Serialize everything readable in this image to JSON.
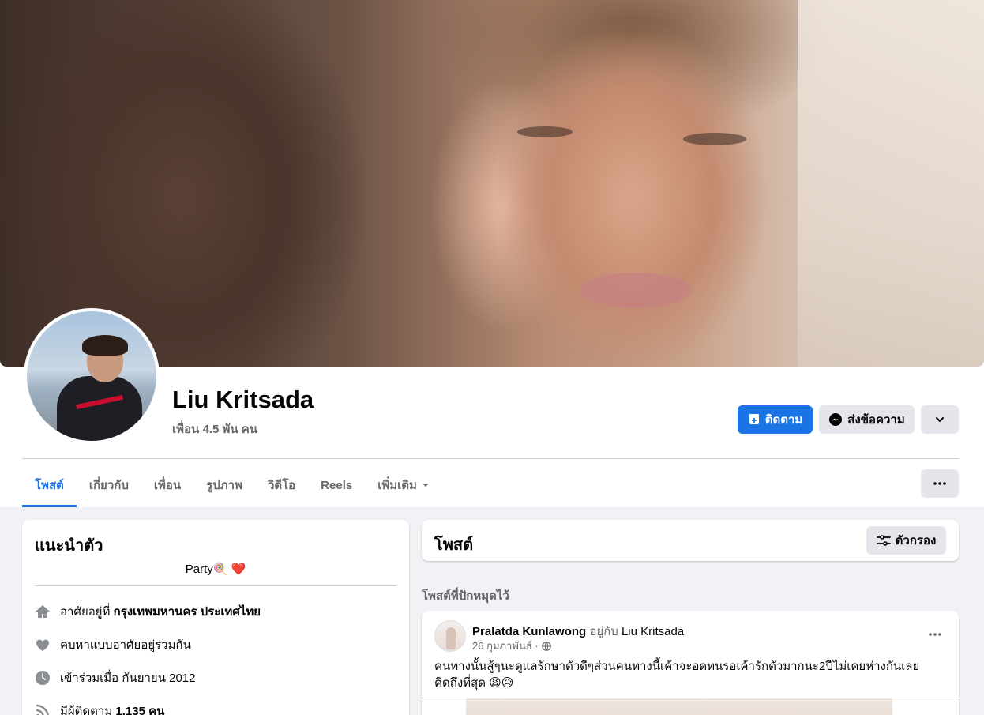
{
  "profile": {
    "name": "Liu Kritsada",
    "friends_count": "เพื่อน 4.5 พัน คน"
  },
  "actions": {
    "follow_label": "ติดตาม",
    "message_label": "ส่งข้อความ"
  },
  "tabs": [
    {
      "label": "โพสต์",
      "active": true
    },
    {
      "label": "เกี่ยวกับ"
    },
    {
      "label": "เพื่อน"
    },
    {
      "label": "รูปภาพ"
    },
    {
      "label": "วิดีโอ"
    },
    {
      "label": "Reels"
    },
    {
      "label": "เพิ่มเติม"
    }
  ],
  "intro": {
    "title": "แนะนำตัว",
    "bio": "Party🍭 ❤️",
    "items": [
      {
        "icon": "home-icon",
        "prefix": "อาศัยอยู่ที่ ",
        "bold": "กรุงเทพมหานคร ประเทศไทย"
      },
      {
        "icon": "heart-icon",
        "prefix": "คบหาแบบอาศัยอยู่ร่วมกัน",
        "bold": ""
      },
      {
        "icon": "clock-icon",
        "prefix": "เข้าร่วมเมื่อ กันยายน 2012",
        "bold": ""
      },
      {
        "icon": "rss-icon",
        "prefix": "มีผู้ติดตาม ",
        "bold": "1,135 คน"
      }
    ]
  },
  "posts_section": {
    "title": "โพสต์",
    "filter_label": "ตัวกรอง",
    "pinned_label": "โพสต์ที่ปักหมุดไว้"
  },
  "post": {
    "author": "Pralatda Kunlawong",
    "with_text": "อยู่กับ",
    "with_name": "Liu Kritsada",
    "date": "26 กุมภาพันธ์ ·",
    "text": "คนทางนั้นสู้ๆนะดูแลรักษาตัวดีๆส่วนคนทางนี้เค้าจะอดทนรอเค้ารักตัวมากนะ2ปีไม่เคยห่างกันเลยคิดถึงที่สุด 😫😥"
  },
  "colors": {
    "accent": "#1b74e4",
    "background": "#f0f2f5",
    "secondary_text": "#65676b"
  }
}
